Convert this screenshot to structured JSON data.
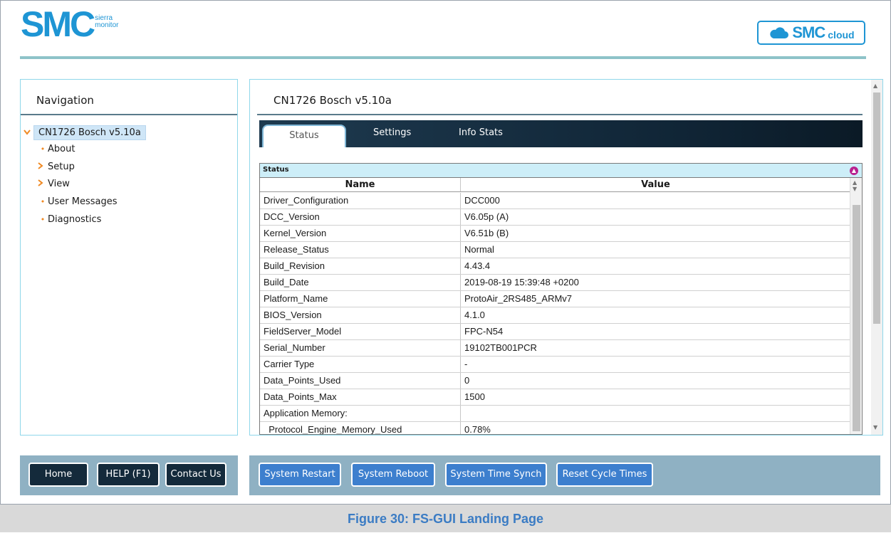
{
  "header": {
    "logo_text": "SMC",
    "logo_subtext_line1": "sierra",
    "logo_subtext_line2": "monitor",
    "cloud_logo_text": "SMC",
    "cloud_logo_subtext": "cloud"
  },
  "nav": {
    "title": "Navigation",
    "root": "CN1726 Bosch v5.10a",
    "items": [
      {
        "label": "About",
        "type": "leaf"
      },
      {
        "label": "Setup",
        "type": "folder"
      },
      {
        "label": "View",
        "type": "folder"
      },
      {
        "label": "User Messages",
        "type": "leaf"
      },
      {
        "label": "Diagnostics",
        "type": "leaf"
      }
    ]
  },
  "main": {
    "title": "CN1726 Bosch v5.10a",
    "tabs": [
      {
        "label": "Status",
        "active": true
      },
      {
        "label": "Settings",
        "active": false
      },
      {
        "label": "Info Stats",
        "active": false
      }
    ],
    "status_section_title": "Status",
    "columns": {
      "name": "Name",
      "value": "Value"
    },
    "rows": [
      {
        "name": "Driver_Configuration",
        "value": "DCC000"
      },
      {
        "name": "DCC_Version",
        "value": "V6.05p (A)"
      },
      {
        "name": "Kernel_Version",
        "value": "V6.51b (B)"
      },
      {
        "name": "Release_Status",
        "value": "Normal"
      },
      {
        "name": "Build_Revision",
        "value": "4.43.4"
      },
      {
        "name": "Build_Date",
        "value": "2019-08-19 15:39:48 +0200"
      },
      {
        "name": "Platform_Name",
        "value": "ProtoAir_2RS485_ARMv7"
      },
      {
        "name": "BIOS_Version",
        "value": "4.1.0"
      },
      {
        "name": "FieldServer_Model",
        "value": "FPC-N54"
      },
      {
        "name": "Serial_Number",
        "value": "19102TB001PCR"
      },
      {
        "name": "Carrier Type",
        "value": "-"
      },
      {
        "name": "Data_Points_Used",
        "value": "0"
      },
      {
        "name": "Data_Points_Max",
        "value": "1500"
      },
      {
        "name": "Application Memory:",
        "value": ""
      },
      {
        "name": "  Protocol_Engine_Memory_Used",
        "value": "0.78%"
      }
    ]
  },
  "nav_buttons": [
    "Home",
    "HELP (F1)",
    "Contact Us"
  ],
  "action_buttons": [
    "System Restart",
    "System Reboot",
    "System Time Synch",
    "Reset Cycle Times"
  ],
  "caption": "Figure 30: FS-GUI Landing Page",
  "colors": {
    "brand_blue": "#1e95d4",
    "accent_orange": "#f08a24",
    "button_dark": "#142a3b",
    "button_blue": "#3d7fce",
    "bar_bg": "#8fb1c3",
    "caption_blue": "#3b7cc4"
  }
}
